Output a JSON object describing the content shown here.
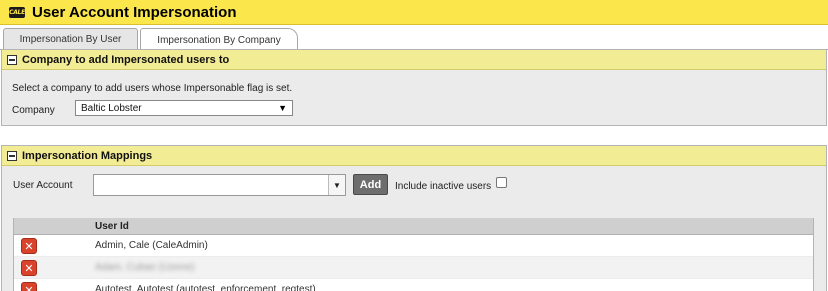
{
  "app": {
    "logo_text": "CALE",
    "title": "User Account Impersonation"
  },
  "tabs": [
    {
      "label": "Impersonation By User",
      "active": false
    },
    {
      "label": "Impersonation By Company",
      "active": true
    }
  ],
  "company_panel": {
    "title": "Company to add Impersonated users to",
    "instruction": "Select a company to add users whose Impersonable flag is set.",
    "company_label": "Company",
    "company_value": "Baltic Lobster"
  },
  "mappings_panel": {
    "title": "Impersonation Mappings",
    "user_account_label": "User Account",
    "user_account_value": "",
    "add_label": "Add",
    "include_inactive_label": "Include inactive users",
    "include_inactive_checked": false,
    "table": {
      "columns": [
        "User Id"
      ],
      "rows": [
        {
          "user_id": "Admin, Cale (CaleAdmin)"
        },
        {
          "user_id": "Adam, Cuban (Uzene)"
        },
        {
          "user_id": "Autotest, Autotest (autotest_enforcement_regtest)"
        }
      ]
    }
  },
  "colors": {
    "title_bar": "#fbe74c",
    "panel_header": "#f2ec94",
    "delete_icon": "#d9432c"
  }
}
